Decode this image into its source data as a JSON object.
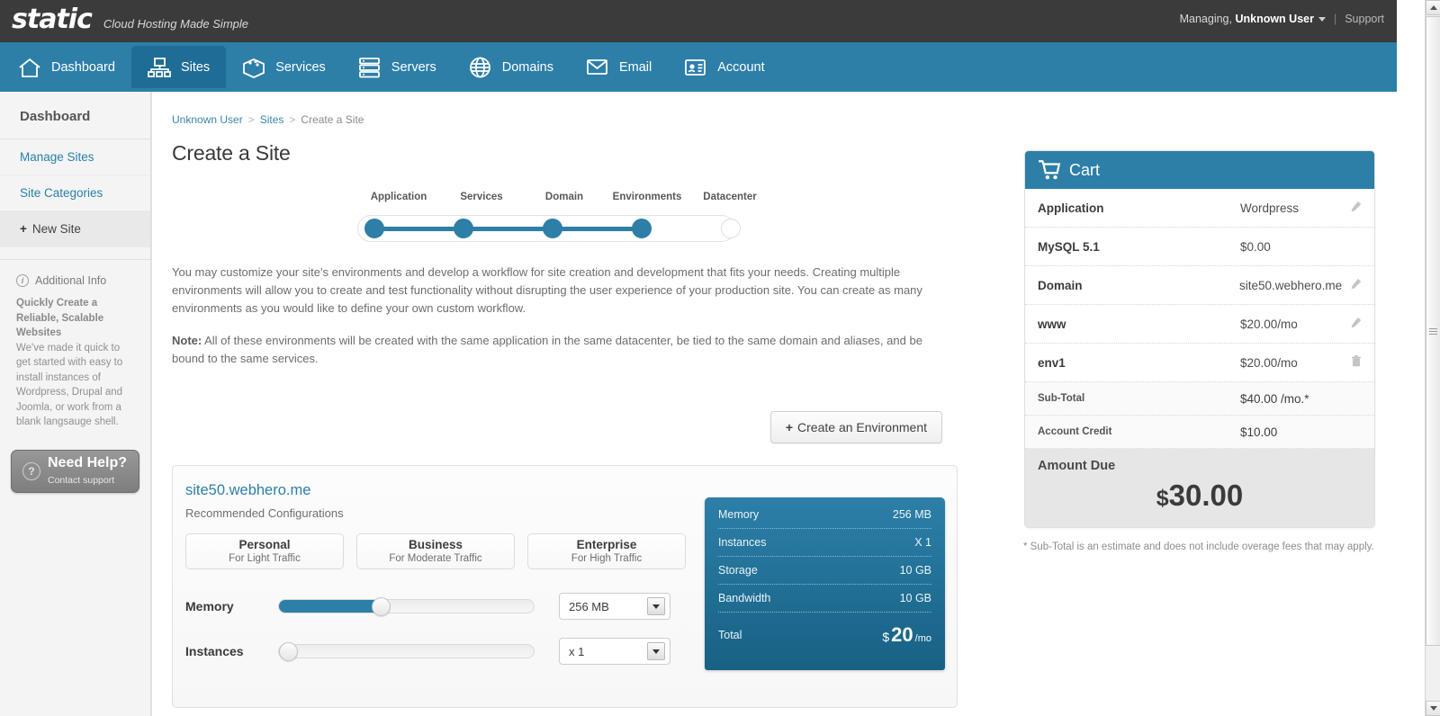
{
  "topbar": {
    "logo": "static",
    "tagline": "Cloud Hosting Made Simple",
    "managing_prefix": "Managing,",
    "managing_user": "Unknown User",
    "separator": "|",
    "support": "Support"
  },
  "nav": {
    "items": [
      {
        "label": "Dashboard",
        "icon": "home-icon",
        "active": false
      },
      {
        "label": "Sites",
        "icon": "sitemap-icon",
        "active": true
      },
      {
        "label": "Services",
        "icon": "box-icon",
        "active": false
      },
      {
        "label": "Servers",
        "icon": "server-rack-icon",
        "active": false
      },
      {
        "label": "Domains",
        "icon": "globe-icon",
        "active": false
      },
      {
        "label": "Email",
        "icon": "envelope-icon",
        "active": false
      },
      {
        "label": "Account",
        "icon": "id-card-icon",
        "active": false
      }
    ]
  },
  "sidebar": {
    "title": "Dashboard",
    "links": [
      {
        "label": "Manage Sites",
        "selected": false
      },
      {
        "label": "Site Categories",
        "selected": false
      },
      {
        "label": "New Site",
        "selected": true,
        "plus": "+"
      }
    ],
    "info_heading": "Additional Info",
    "info_bold": "Quickly Create a Reliable, Scalable Websites",
    "info_body": "We've made it quick to get started with easy to install instances of Wordpress, Drupal and Joomla, or work from a blank langsauge shell.",
    "help_title": "Need Help?",
    "help_sub": "Contact support",
    "help_icon": "question-mark-icon"
  },
  "breadcrumb": {
    "items": [
      "Unknown User",
      "Sites",
      "Create a Site"
    ],
    "separator": ">"
  },
  "page": {
    "title": "Create a Site",
    "paragraph": "You may customize your site's environments and develop a workflow for site creation and development that fits your needs. Creating multiple environments will allow you to create and test functionality without disrupting the user experience of your production site. You can create as many environments as you would like to define your own custom workflow.",
    "note_label": "Note:",
    "note_text": " All of these environments will be created with the same application in the same datacenter, be tied to the same domain and aliases, and be bound to the same services.",
    "create_env_button": "Create an Environment",
    "create_env_plus": "+"
  },
  "stepper": {
    "steps": [
      {
        "label": "Application",
        "complete": true
      },
      {
        "label": "Services",
        "complete": true
      },
      {
        "label": "Domain",
        "complete": true
      },
      {
        "label": "Environments",
        "complete": true
      },
      {
        "label": "Datacenter",
        "complete": false
      }
    ]
  },
  "envcard": {
    "name": "site50.webhero.me",
    "subtitle": "Recommended Configurations",
    "presets": [
      {
        "title": "Personal",
        "sub": "For Light Traffic"
      },
      {
        "title": "Business",
        "sub": "For Moderate Traffic"
      },
      {
        "title": "Enterprise",
        "sub": "For High Traffic"
      }
    ],
    "sliders": [
      {
        "label": "Memory",
        "value": "256 MB",
        "percent": 39
      },
      {
        "label": "Instances",
        "value": "x 1",
        "percent": 0
      }
    ],
    "summary": {
      "rows": [
        {
          "k": "Memory",
          "v": "256 MB"
        },
        {
          "k": "Instances",
          "v": "X 1"
        },
        {
          "k": "Storage",
          "v": "10 GB"
        },
        {
          "k": "Bandwidth",
          "v": "10 GB"
        }
      ],
      "total_label": "Total",
      "total_currency": "$",
      "total_value": "20",
      "total_period": "/mo"
    }
  },
  "cart": {
    "title": "Cart",
    "icon": "shopping-cart-icon",
    "rows": [
      {
        "k": "Application",
        "v": "Wordpress",
        "action": "edit-icon"
      },
      {
        "k": "MySQL 5.1",
        "v": "$0.00",
        "action": ""
      },
      {
        "k": "Domain",
        "v": "site50.webhero.me",
        "action": "edit-icon"
      },
      {
        "k": "www",
        "v": "$20.00/mo",
        "action": "edit-icon"
      },
      {
        "k": "env1",
        "v": "$20.00/mo",
        "action": "trash-icon"
      }
    ],
    "subtotal_label": "Sub-Total",
    "subtotal_value": "$40.00 /mo.*",
    "credit_label": "Account Credit",
    "credit_value": "$10.00",
    "due_label": "Amount Due",
    "due_dollar": "$",
    "due_amount": "30.00",
    "note": "* Sub-Total is an estimate and does not include overage fees that may apply."
  },
  "colors": {
    "brand_blue": "#2d7fa8",
    "nav_active": "#1f6d96",
    "topbar_dark": "#3b3b3b",
    "link_blue": "#3a87ad"
  }
}
